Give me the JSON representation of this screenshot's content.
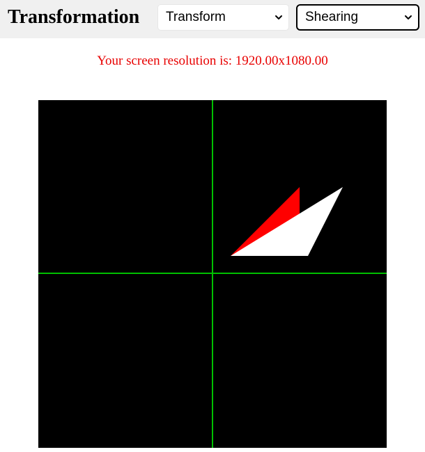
{
  "header": {
    "title": "Transformation",
    "transform_select": {
      "value": "Transform",
      "icon": "chevron-down-icon"
    },
    "mode_select": {
      "value": "Shearing",
      "icon": "chevron-down-icon"
    }
  },
  "info": {
    "resolution_text": "Your screen resolution is: 1920.00x1080.00"
  },
  "canvas": {
    "background": "#000000",
    "axis_color": "#00c000",
    "shapes": [
      {
        "name": "original-triangle",
        "color": "#ff0000"
      },
      {
        "name": "sheared-triangle",
        "color": "#ffffff"
      }
    ]
  }
}
